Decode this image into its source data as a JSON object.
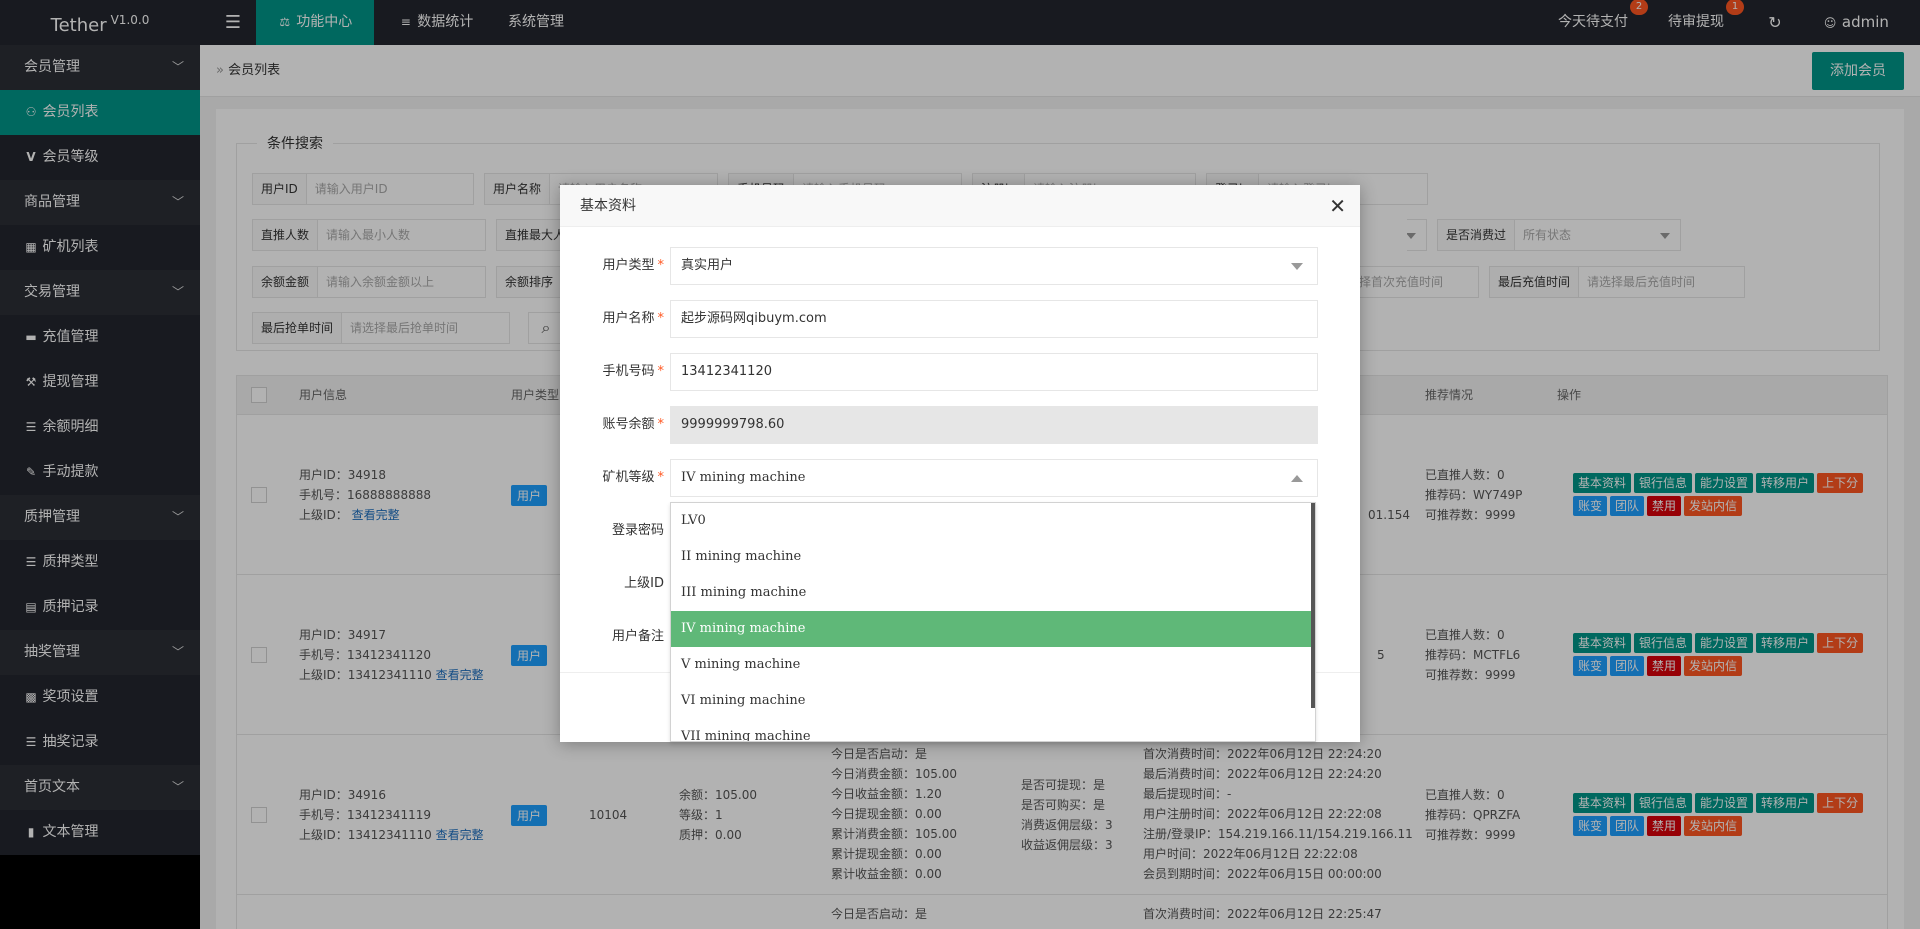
{
  "topbar": {
    "logo": "Tether",
    "version": "V1.0.0",
    "menu_icon": "hamburger-icon",
    "nav": [
      {
        "label": "功能中心",
        "icon": "balance-icon"
      },
      {
        "label": "数据统计",
        "icon": "database-icon"
      },
      {
        "label": "系统管理"
      }
    ],
    "pay_today": "今天待支付",
    "pay_today_count": "2",
    "withdraw": "待审提现",
    "withdraw_count": "1",
    "refresh_icon": "refresh-icon",
    "user": "admin"
  },
  "sidebar": {
    "groups": [
      {
        "label": "会员管理",
        "items": [
          "会员列表",
          "会员等级"
        ]
      },
      {
        "label": "商品管理",
        "items": [
          "矿机列表"
        ]
      },
      {
        "label": "交易管理",
        "items": [
          "充值管理",
          "提现管理",
          "余额明细",
          "手动提款"
        ]
      },
      {
        "label": "质押管理",
        "items": [
          "质押类型",
          "质押记录"
        ]
      },
      {
        "label": "抽奖管理",
        "items": [
          "奖项设置",
          "抽奖记录"
        ]
      },
      {
        "label": "首页文本",
        "items": [
          "文本管理"
        ]
      }
    ]
  },
  "breadcrumb": {
    "text": "会员列表",
    "add_button": "添加会员"
  },
  "search": {
    "legend": "条件搜索",
    "fields": [
      {
        "label": "用户ID",
        "placeholder": "请输入用户ID"
      },
      {
        "label": "用户名称",
        "placeholder": "请输入用户名称"
      },
      {
        "label": "手机号码",
        "placeholder": "请输入手机号码"
      },
      {
        "label": "注册ip",
        "placeholder": "请输入注册ip"
      },
      {
        "label": "登录ip",
        "placeholder": "请输入登录ip"
      },
      {
        "label": "直推人数",
        "placeholder": "请输入最小人数"
      },
      {
        "label": "直推最大人",
        "placeholder": ""
      },
      {
        "label": "是否消费过",
        "placeholder": "所有状态"
      },
      {
        "label": "余额金额",
        "placeholder": "请输入余额金额以上"
      },
      {
        "label": "余额排序",
        "placeholder": ""
      },
      {
        "label": "",
        "placeholder": "择首次充值时间"
      },
      {
        "label": "最后充值时间",
        "placeholder": "请选择最后充值时间"
      },
      {
        "label": "最后抢单时间",
        "placeholder": "请选择最后抢单时间"
      }
    ],
    "search_icon": "search-icon"
  },
  "table": {
    "headers": [
      "用户信息",
      "用户类型",
      "推荐情况",
      "操作"
    ],
    "ops": [
      "基本资料",
      "银行信息",
      "能力设置",
      "转移用户",
      "上下分",
      "账变",
      "团队",
      "禁用",
      "发站内信"
    ],
    "rows": [
      {
        "id": "用户ID：34918",
        "phone": "手机号：16888888888",
        "parent": "上级ID：",
        "view": "查看完整",
        "type": "用户",
        "partial_ip": "01.154",
        "ref": [
          "已直推人数：0",
          "推荐码：WY749P",
          "可推荐数：9999"
        ]
      },
      {
        "id": "用户ID：34917",
        "phone": "手机号：13412341120",
        "parent": "上级ID：13412341110",
        "view": "查看完整",
        "type": "用户",
        "partial_ip": "5",
        "ref": [
          "已直推人数：0",
          "推荐码：MCTFL6",
          "可推荐数：9999"
        ]
      },
      {
        "id": "用户ID：34916",
        "phone": "手机号：13412341119",
        "parent": "上级ID：13412341110",
        "view": "查看完整",
        "type": "用户",
        "code": "10104",
        "money": [
          "余额：105.00",
          "等级：1",
          "质押：0.00"
        ],
        "today": [
          "今日是否启动：是",
          "今日消费金额：105.00",
          "今日收益金额：1.20",
          "今日提现金额：0.00",
          "累计消费金额：105.00",
          "累计提现金额：0.00",
          "累计收益金额：0.00"
        ],
        "flags": [
          "是否可提现：是",
          "是否可购买：是",
          "消费返佣层级：3",
          "收益返佣层级：3"
        ],
        "times": [
          "首次消费时间：2022年06月12日 22:24:20",
          "最后消费时间：2022年06月12日 22:24:20",
          "最后提现时间：-",
          "用户注册时间：2022年06月12日 22:22:08",
          "注册/登录IP：154.219.166.11/154.219.166.11",
          "用户时间：2022年06月12日 22:22:08",
          "会员到期时间：2022年06月15日 00:00:00"
        ],
        "ref": [
          "已直推人数：0",
          "推荐码：QPRZFA",
          "可推荐数：9999"
        ]
      },
      {
        "today": [
          "今日是否启动：是"
        ],
        "times": [
          "首次消费时间：2022年06月12日 22:25:47"
        ]
      }
    ]
  },
  "modal": {
    "title": "基本资料",
    "close_icon": "close-icon",
    "fields": [
      {
        "label": "用户类型",
        "value": "真实用户",
        "required": true
      },
      {
        "label": "用户名称",
        "value": "起步源码网qibuym.com",
        "required": true
      },
      {
        "label": "手机号码",
        "value": "13412341120",
        "required": true
      },
      {
        "label": "账号余额",
        "value": "9999999798.60",
        "required": true
      },
      {
        "label": "矿机等级",
        "value": "IV mining machine",
        "required": true
      },
      {
        "label": "登录密码",
        "value": ""
      },
      {
        "label": "上级ID",
        "value": ""
      },
      {
        "label": "用户备注",
        "value": ""
      }
    ],
    "options": [
      "LV0",
      "II mining machine",
      "III mining machine",
      "IV mining machine",
      "V mining machine",
      "VI mining machine",
      "VII mining machine"
    ],
    "selected_option": "IV mining machine"
  },
  "colors": {
    "accent": "#009688",
    "sidebar": "#23262e",
    "selected_option": "#5fb878",
    "danger": "#d9000a",
    "warn": "#ff5722",
    "info": "#1e9fff"
  }
}
